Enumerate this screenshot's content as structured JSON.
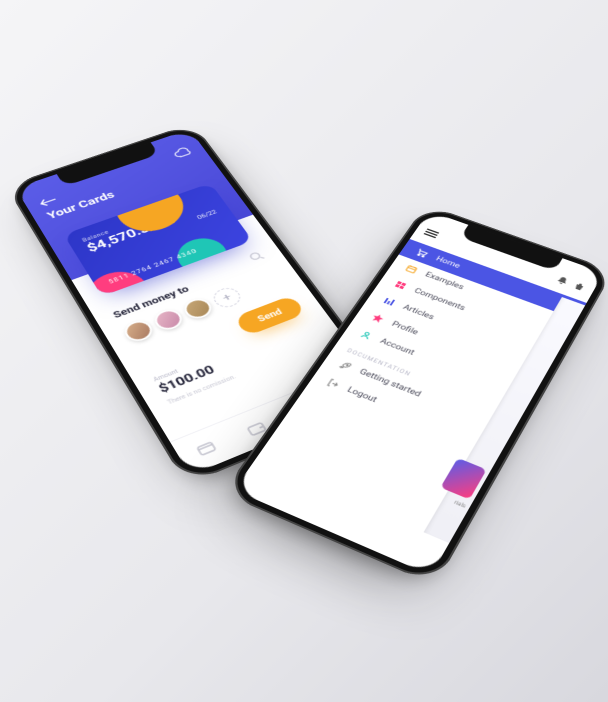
{
  "app1": {
    "title": "Your Cards",
    "card": {
      "balance_label": "Balance",
      "balance": "$4,570.30",
      "expiry": "06/22",
      "digits": "5811  2764  2467  4340"
    },
    "search_icon": "search",
    "send_title": "Send money to",
    "add_label": "+",
    "send_button": "Send",
    "amount_label": "Amount",
    "amount_value": "$100.00",
    "commission_note": "There is no comission."
  },
  "app2": {
    "menu": [
      {
        "icon": "cart",
        "label": "Home",
        "active": true
      },
      {
        "icon": "calendar",
        "label": "Examples"
      },
      {
        "icon": "grid",
        "label": "Components"
      },
      {
        "icon": "bars",
        "label": "Articles"
      },
      {
        "icon": "star",
        "label": "Profile"
      },
      {
        "icon": "user",
        "label": "Account"
      }
    ],
    "section_label": "DOCUMENTATION",
    "docs": [
      {
        "icon": "rocket",
        "label": "Getting started"
      },
      {
        "icon": "logout",
        "label": "Logout"
      }
    ],
    "peek_label": "rials"
  }
}
